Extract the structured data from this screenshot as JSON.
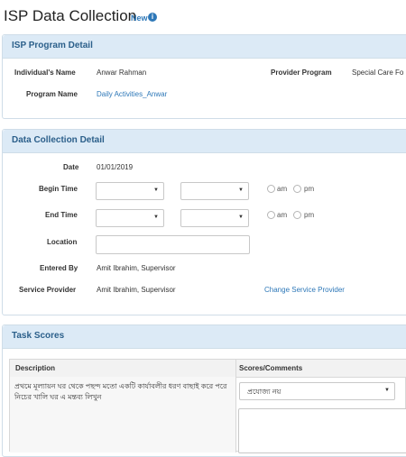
{
  "header": {
    "title": "ISP Data Collection",
    "badge": "New",
    "info_glyph": "i"
  },
  "program_detail": {
    "title": "ISP Program Detail",
    "individual_label": "Individual's Name",
    "individual_value": "Anwar Rahman",
    "provider_program_label": "Provider Program",
    "provider_program_value": "Special Care Fo",
    "program_name_label": "Program Name",
    "program_name_value": "Daily Activities_Anwar"
  },
  "data_collection": {
    "title": "Data Collection Detail",
    "date_label": "Date",
    "date_value": "01/01/2019",
    "begin_time_label": "Begin Time",
    "end_time_label": "End Time",
    "am_label": "am",
    "pm_label": "pm",
    "location_label": "Location",
    "location_value": "",
    "entered_by_label": "Entered By",
    "entered_by_value": "Amit Ibrahim, Supervisor",
    "service_provider_label": "Service Provider",
    "service_provider_value": "Amit Ibrahim, Supervisor",
    "change_provider_link": "Change Service Provider",
    "caret_glyph": "▼"
  },
  "task_scores": {
    "title": "Task Scores",
    "col_description": "Description",
    "col_scores": "Scores/Comments",
    "row_description": "প্রথমে মূল্যায়ন ঘর থেকে পছন্দ মতো একটি কার্যাবলীর ধরণ বাছাই করে পরে নিচের খালি ঘর এ মন্তব্য লিখুন",
    "score_select_value": "প্রযোজ্য নয়",
    "comment_value": ""
  }
}
